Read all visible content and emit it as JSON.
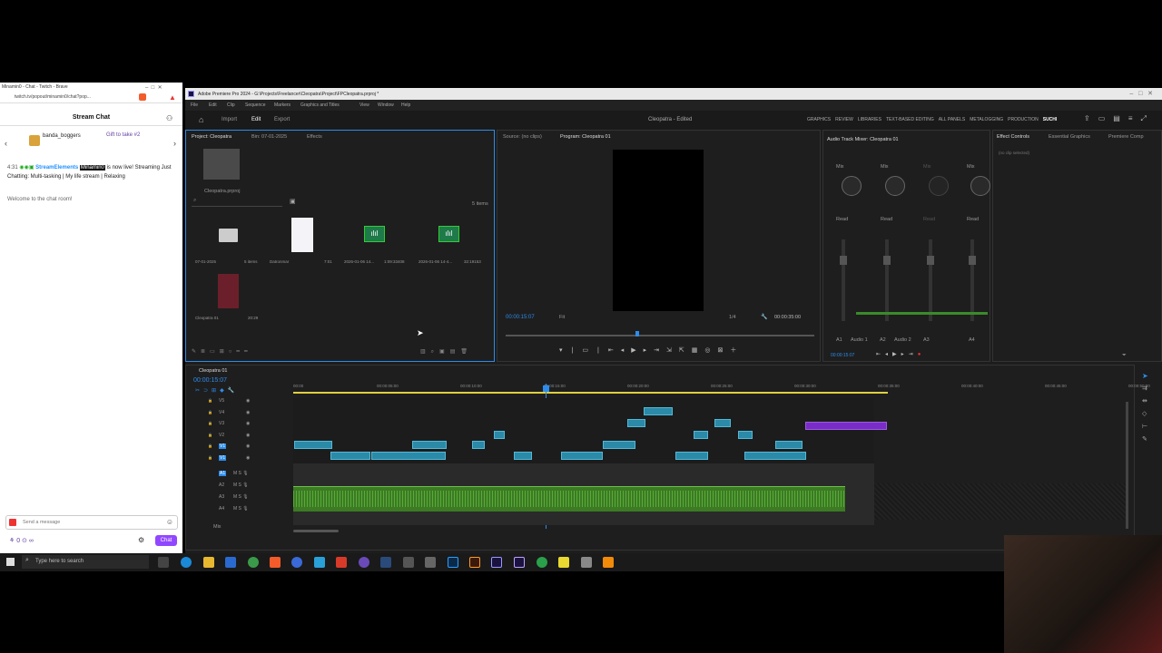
{
  "chat_window": {
    "tab_title": "Minamin0 - Chat - Twitch - Brave",
    "url": "twitch.tv/popout/minamin0/chat?pop...",
    "header": "Stream Chat",
    "pinned_user": "banda_boggers",
    "gift_text": "Gift to take #2",
    "message_time": "4:31",
    "message_user": "StreamElements",
    "message_highlight": "Minamin0",
    "message_text": "is now live! Streaming Just Chatting: Multi-tasking | My life stream | Relaxing",
    "welcome": "Welcome to the chat room!",
    "input_placeholder": "Send a message",
    "chat_button": "Chat"
  },
  "premiere": {
    "title": "Adobe Premiere Pro 2024 - G:\\Projects\\Freelancer\\Cleopatra\\Project\\FPCleopatra.prproj *",
    "menu": [
      "File",
      "Edit",
      "Clip",
      "Sequence",
      "Markers",
      "Graphics and Titles",
      "View",
      "Window",
      "Help"
    ],
    "modes": [
      "Import",
      "Edit",
      "Export"
    ],
    "center_title": "Cleopatra - Edited",
    "workspaces": [
      "GRAPHICS",
      "REVIEW",
      "LIBRARIES",
      "TEXT-BASED EDITING",
      "ALL PANELS",
      "METALOGGING",
      "PRODUCTION",
      "SUCHI"
    ],
    "project_panel": {
      "tabs": [
        "Project: Cleopatra",
        "Bin: 07-01-2025",
        "Effects"
      ],
      "file_name": "Cleopatra.prproj",
      "item_count": "5 items",
      "items": [
        {
          "name": "07-01-2025",
          "meta": "5 items",
          "icon": "folder-icon"
        },
        {
          "name": "Datronmar",
          "meta": "7:01",
          "icon": "image-icon"
        },
        {
          "name": "2026-01-06 14...",
          "meta": "1:09:33408",
          "icon": "audio-wave-icon"
        },
        {
          "name": "2026-01-06 14-4...",
          "meta": "32:19153",
          "icon": "audio-wave-icon"
        },
        {
          "name": "Cleopatra 01",
          "meta": "20:29",
          "icon": "sequence-thumb-icon"
        }
      ]
    },
    "source_tab": "Source: (no clips)",
    "program_tab": "Program: Cleopatra 01",
    "program_timecode": "00:00:15:07",
    "fit_label": "Fit",
    "quality": "1/4",
    "duration": "00:00:35:00",
    "audio_mixer": {
      "tab": "Audio Track Mixer: Cleopatra 01",
      "mix_labels": [
        "Mix",
        "Mix",
        "Mix",
        "Mix"
      ],
      "read_labels": [
        "Read",
        "Read",
        "Read",
        "Read"
      ],
      "channels": [
        "A1",
        "Audio 1",
        "A2",
        "Audio 2",
        "A3",
        "A4"
      ],
      "timecode": "00:00:15:07"
    },
    "effect_controls": {
      "tabs": [
        "Effect Controls",
        "Essential Graphics",
        "Premiere Comp"
      ],
      "empty": "(no clip selected)"
    },
    "timeline": {
      "tab": "Cleopatra 01",
      "timecode": "00:00:15:07",
      "ruler": [
        "00:00",
        "00:00:05:00",
        "00:00:10:00",
        "00:00:15:00",
        "00:00:20:00",
        "00:00:25:00",
        "00:00:30:00",
        "00:00:35:00",
        "00:00:40:00",
        "00:00:45:00",
        "00:00:50:00"
      ],
      "video_tracks": [
        "V5",
        "V4",
        "V3",
        "V2",
        "V1",
        "V1"
      ],
      "audio_tracks": [
        "A1",
        "A2",
        "A3",
        "A4"
      ],
      "mix_label": "Mix"
    }
  },
  "taskbar": {
    "search_placeholder": "Type here to search"
  },
  "colors": {
    "accent_blue": "#2d8ceb",
    "clip_cyan": "#2a8aa8",
    "clip_purple": "#7a2cc9",
    "audio_green": "#4c9a2a",
    "twitch_purple": "#9147ff"
  }
}
